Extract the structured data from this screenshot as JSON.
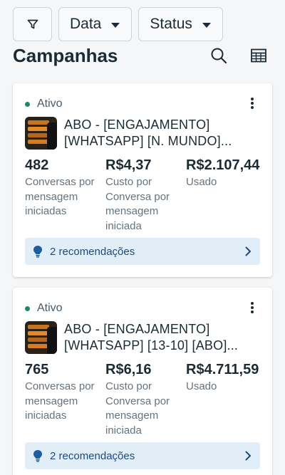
{
  "filters": {
    "filter_icon": "filter-funnel-icon",
    "date_label": "Data",
    "status_label": "Status"
  },
  "header": {
    "title": "Campanhas",
    "search_icon": "search-icon",
    "table_icon": "table-view-icon"
  },
  "colors": {
    "active_dot": "#1f8a5b",
    "recommendation_bg": "#e1eef7",
    "recommendation_text": "#1d4a7a"
  },
  "campaigns": [
    {
      "status": "Ativo",
      "name": "ABO - [ENGAJAMENTO] [WHATSAPP] [N. MUNDO]...",
      "metrics": [
        {
          "value": "482",
          "label": "Conversas por mensagem iniciadas"
        },
        {
          "value": "R$4,37",
          "label": "Custo por Conversa por mensagem iniciada"
        },
        {
          "value": "R$2.107,44",
          "label": "Usado"
        }
      ],
      "recommendations": "2 recomendações"
    },
    {
      "status": "Ativo",
      "name": "ABO - [ENGAJAMENTO] [WHATSAPP] [13-10] [ABO]...",
      "metrics": [
        {
          "value": "765",
          "label": "Conversas por mensagem iniciadas"
        },
        {
          "value": "R$6,16",
          "label": "Custo por Conversa por mensagem iniciada"
        },
        {
          "value": "R$4.711,59",
          "label": "Usado"
        }
      ],
      "recommendations": "2 recomendações"
    }
  ]
}
